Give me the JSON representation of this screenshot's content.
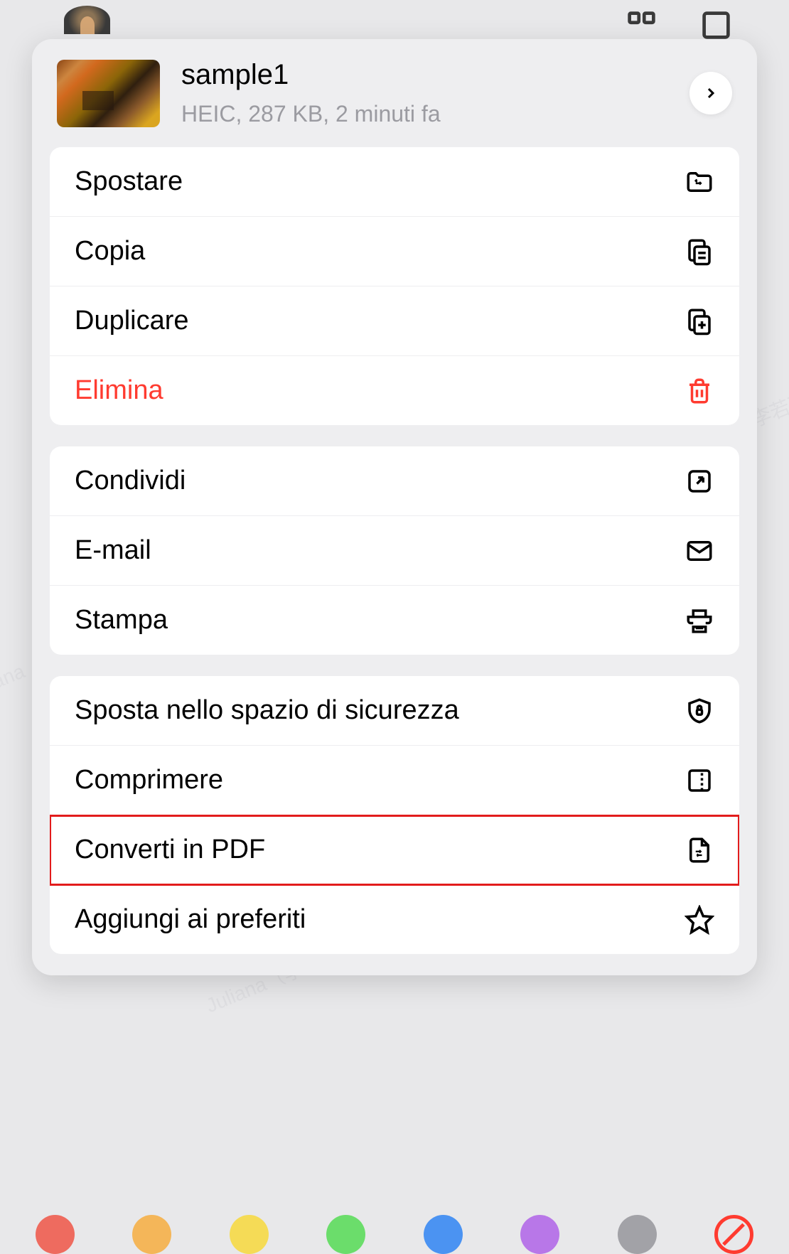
{
  "file": {
    "name": "sample1",
    "meta": "HEIC, 287 KB, 2 minuti fa"
  },
  "sections": [
    {
      "items": [
        {
          "label": "Spostare",
          "icon": "folder-move",
          "danger": false
        },
        {
          "label": "Copia",
          "icon": "copy",
          "danger": false
        },
        {
          "label": "Duplicare",
          "icon": "duplicate",
          "danger": false
        },
        {
          "label": "Elimina",
          "icon": "trash",
          "danger": true
        }
      ]
    },
    {
      "items": [
        {
          "label": "Condividi",
          "icon": "share",
          "danger": false
        },
        {
          "label": "E-mail",
          "icon": "mail",
          "danger": false
        },
        {
          "label": "Stampa",
          "icon": "printer",
          "danger": false
        }
      ]
    },
    {
      "items": [
        {
          "label": "Sposta nello spazio di sicurezza",
          "icon": "shield-lock",
          "danger": false,
          "highlighted": false
        },
        {
          "label": "Comprimere",
          "icon": "compress",
          "danger": false,
          "highlighted": false
        },
        {
          "label": "Converti in PDF",
          "icon": "convert",
          "danger": false,
          "highlighted": true
        },
        {
          "label": "Aggiungi ai preferiti",
          "icon": "star",
          "danger": false,
          "highlighted": false
        }
      ]
    }
  ],
  "colors": [
    {
      "hex": "#ee6b5f"
    },
    {
      "hex": "#f4b659"
    },
    {
      "hex": "#f5db56"
    },
    {
      "hex": "#6bdd6b"
    },
    {
      "hex": "#4b93f2"
    },
    {
      "hex": "#b877e8"
    },
    {
      "hex": "#a2a2a7"
    }
  ]
}
